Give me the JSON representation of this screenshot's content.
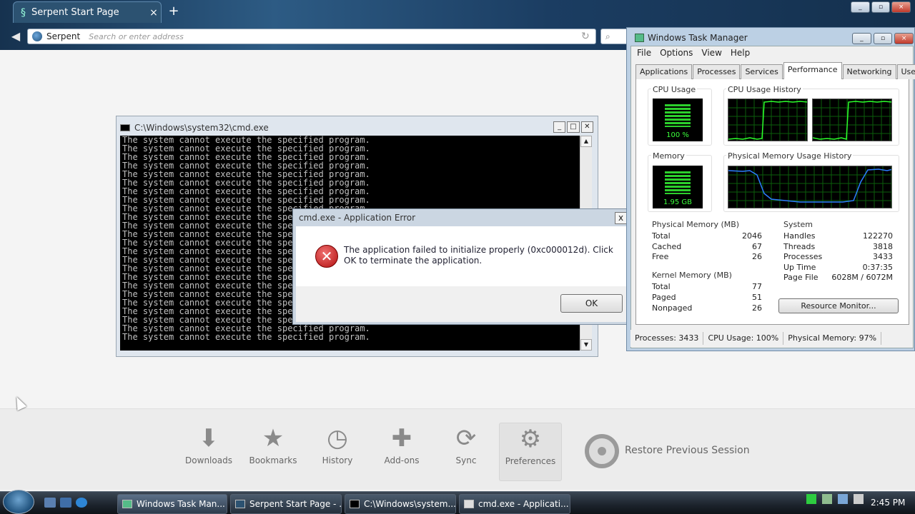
{
  "browser": {
    "tab_title": "Serpent Start Page",
    "tab_close": "×",
    "new_tab": "+",
    "identity": "Serpent",
    "address_placeholder": "Search or enter address",
    "reload": "↻",
    "search_glyph": "🔍"
  },
  "start_page": {
    "launchers": [
      {
        "label": "Downloads",
        "icon": "download-icon"
      },
      {
        "label": "Bookmarks",
        "icon": "star-icon"
      },
      {
        "label": "History",
        "icon": "clock-icon"
      },
      {
        "label": "Add-ons",
        "icon": "puzzle-icon"
      },
      {
        "label": "Sync",
        "icon": "sync-icon"
      },
      {
        "label": "Preferences",
        "icon": "gear-icon"
      }
    ],
    "restore_session": "Restore Previous Session"
  },
  "cmd": {
    "title": "C:\\Windows\\system32\\cmd.exe",
    "line": "The system cannot execute the specified program.",
    "line_count": 24
  },
  "error_dialog": {
    "title": "cmd.exe - Application Error",
    "message": "The application failed to initialize properly (0xc000012d). Click OK to terminate the application.",
    "ok": "OK",
    "close": "x"
  },
  "task_manager": {
    "title": "Windows Task Manager",
    "menu": [
      "File",
      "Options",
      "View",
      "Help"
    ],
    "tabs": [
      "Applications",
      "Processes",
      "Services",
      "Performance",
      "Networking",
      "Users"
    ],
    "active_tab": "Performance",
    "cpu_usage_label": "CPU Usage",
    "cpu_usage_value": "100 %",
    "cpu_history_label": "CPU Usage History",
    "memory_label": "Memory",
    "memory_value": "1.95 GB",
    "mem_history_label": "Physical Memory Usage History",
    "physical_memory": {
      "heading": "Physical Memory (MB)",
      "rows": [
        {
          "label": "Total",
          "value": "2046"
        },
        {
          "label": "Cached",
          "value": "67"
        },
        {
          "label": "Free",
          "value": "26"
        }
      ]
    },
    "kernel_memory": {
      "heading": "Kernel Memory (MB)",
      "rows": [
        {
          "label": "Total",
          "value": "77"
        },
        {
          "label": "Paged",
          "value": "51"
        },
        {
          "label": "Nonpaged",
          "value": "26"
        }
      ]
    },
    "system": {
      "heading": "System",
      "rows": [
        {
          "label": "Handles",
          "value": "122270"
        },
        {
          "label": "Threads",
          "value": "3818"
        },
        {
          "label": "Processes",
          "value": "3433"
        },
        {
          "label": "Up Time",
          "value": "0:37:35"
        },
        {
          "label": "Page File",
          "value": "6028M / 6072M"
        }
      ]
    },
    "resource_monitor": "Resource Monitor...",
    "status": {
      "processes": "Processes: 3433",
      "cpu": "CPU Usage: 100%",
      "memory": "Physical Memory: 97%"
    }
  },
  "taskbar": {
    "buttons": [
      "Windows Task Man...",
      "Serpent Start Page - ...",
      "C:\\Windows\\system...",
      "cmd.exe - Applicati..."
    ],
    "clock": "2:45 PM"
  }
}
